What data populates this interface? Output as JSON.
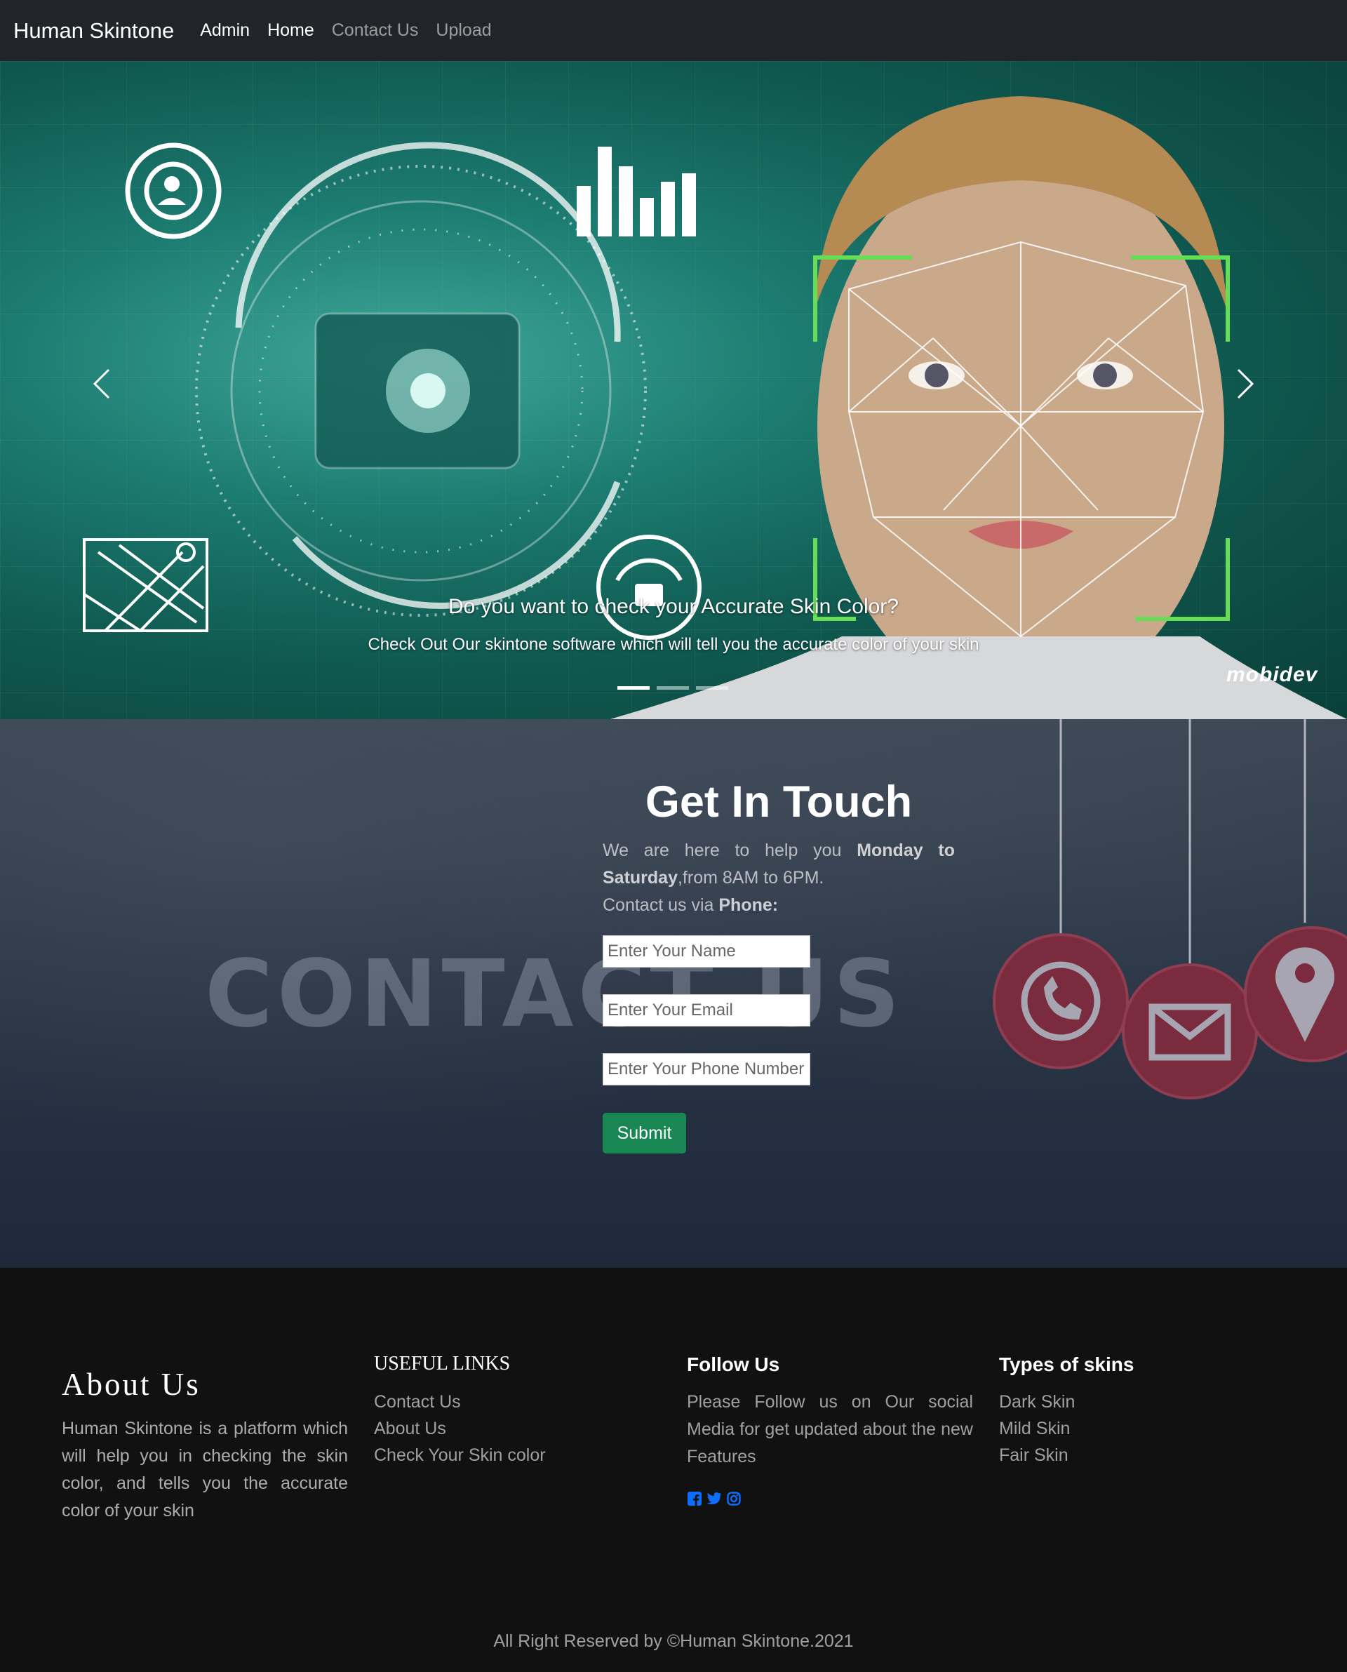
{
  "navbar": {
    "brand": "Human Skintone",
    "links": [
      "Admin",
      "Home",
      "Contact Us",
      "Upload"
    ]
  },
  "hero": {
    "caption_title": "Do you want to check your Accurate Skin Color?",
    "caption_text": "Check Out Our skintone software which will tell you the accurate color of your skin",
    "watermark": "mobidev",
    "slide_count": 3,
    "active_slide": 1
  },
  "contact": {
    "background_text": "CONTACT US",
    "title": "Get In Touch",
    "text_1": "We are here to help you ",
    "text_bold_days": "Monday to Saturday",
    "text_2": ",from 8AM to 6PM.",
    "text_3": "Contact us via ",
    "text_bold_phone": "Phone:",
    "name_placeholder": "Enter Your Name",
    "email_placeholder": "Enter Your Email",
    "phone_placeholder": "Enter Your Phone Number",
    "submit_label": "Submit"
  },
  "footer": {
    "about_title": "About Us",
    "about_text": "Human Skintone is a platform which will help you in checking the skin color, and tells you the accurate color of your skin",
    "links_title": "USEFUL LINKS",
    "links": [
      "Contact Us",
      "About Us",
      "Check Your Skin color"
    ],
    "follow_title": "Follow Us",
    "follow_text": "Please Follow us on Our social Media for get updated about the new Features",
    "social_icons": [
      "facebook-icon",
      "twitter-icon",
      "instagram-icon"
    ],
    "types_title": "Types of skins",
    "types": [
      "Dark Skin",
      "Mild Skin",
      "Fair Skin"
    ],
    "copyright": "All Right Reserved by ©Human Skintone.2021"
  },
  "colors": {
    "navbar_bg": "#212529",
    "submit_bg": "#198754",
    "social_blue": "#0d6efd",
    "footer_bg": "#111111"
  }
}
